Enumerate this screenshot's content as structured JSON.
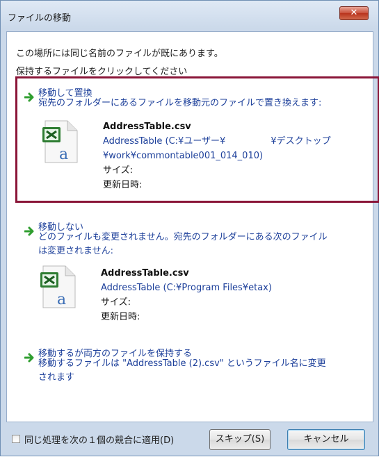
{
  "window": {
    "title": "ファイルの移動",
    "close_label": "✕"
  },
  "intro": {
    "line1": "この場所には同じ名前のファイルが既にあります。",
    "line2": "保持するファイルをクリックしてください"
  },
  "options": [
    {
      "title": "移動して置換",
      "description": [
        "宛先のフォルダーにあるファイルを移動元のファイルで置き換えます:"
      ],
      "file": {
        "name": "AddressTable.csv",
        "path_lines": [
          "AddressTable (C:¥ユーザー¥　　　　　¥デスクトップ",
          "¥work¥commontable001_014_010)"
        ],
        "size_label": "サイズ:",
        "date_label": "更新日時:"
      }
    },
    {
      "title": "移動しない",
      "description": [
        "どのファイルも変更されません。宛先のフォルダーにある次のファイル",
        "は変更されません:"
      ],
      "file": {
        "name": "AddressTable.csv",
        "path_lines": [
          "AddressTable (C:¥Program Files¥etax)"
        ],
        "size_label": "サイズ:",
        "date_label": "更新日時:"
      }
    },
    {
      "title": "移動するが両方のファイルを保持する",
      "description": [
        "移動するファイルは \"AddressTable (2).csv\" というファイル名に変更",
        "されます"
      ]
    }
  ],
  "footer": {
    "apply_checkbox_label": "同じ処理を次の１個の競合に適用(D)",
    "skip_button": "スキップ(S)",
    "cancel_button": "キャンセル"
  },
  "colors": {
    "link_text": "#1c3f9a",
    "highlight_border": "#8a1538",
    "arrow_green": "#2f9e2f"
  },
  "icons": [
    "close-icon",
    "green-arrow-icon",
    "excel-csv-file-icon"
  ]
}
